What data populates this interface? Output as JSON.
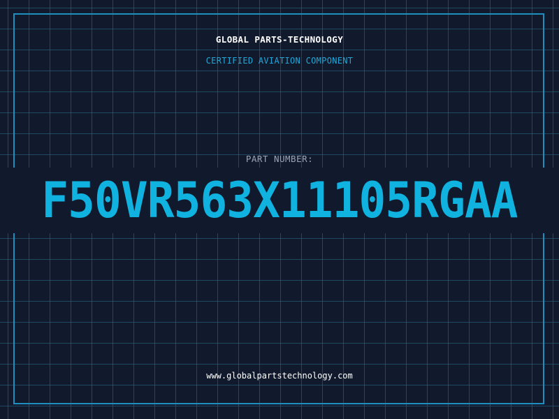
{
  "header": {
    "brand": "GLOBAL PARTS-TECHNOLOGY",
    "tagline": "CERTIFIED AVIATION COMPONENT"
  },
  "part": {
    "label": "PART NUMBER:",
    "number": "F50VR563X11105RGAA"
  },
  "footer": {
    "url": "www.globalpartstechnology.com"
  },
  "colors": {
    "background": "#111a2c",
    "grid": "#2d6e8c",
    "frame": "#1f8fbf",
    "accent": "#10b2e0",
    "label": "#9aa6b6",
    "text": "#ffffff"
  }
}
